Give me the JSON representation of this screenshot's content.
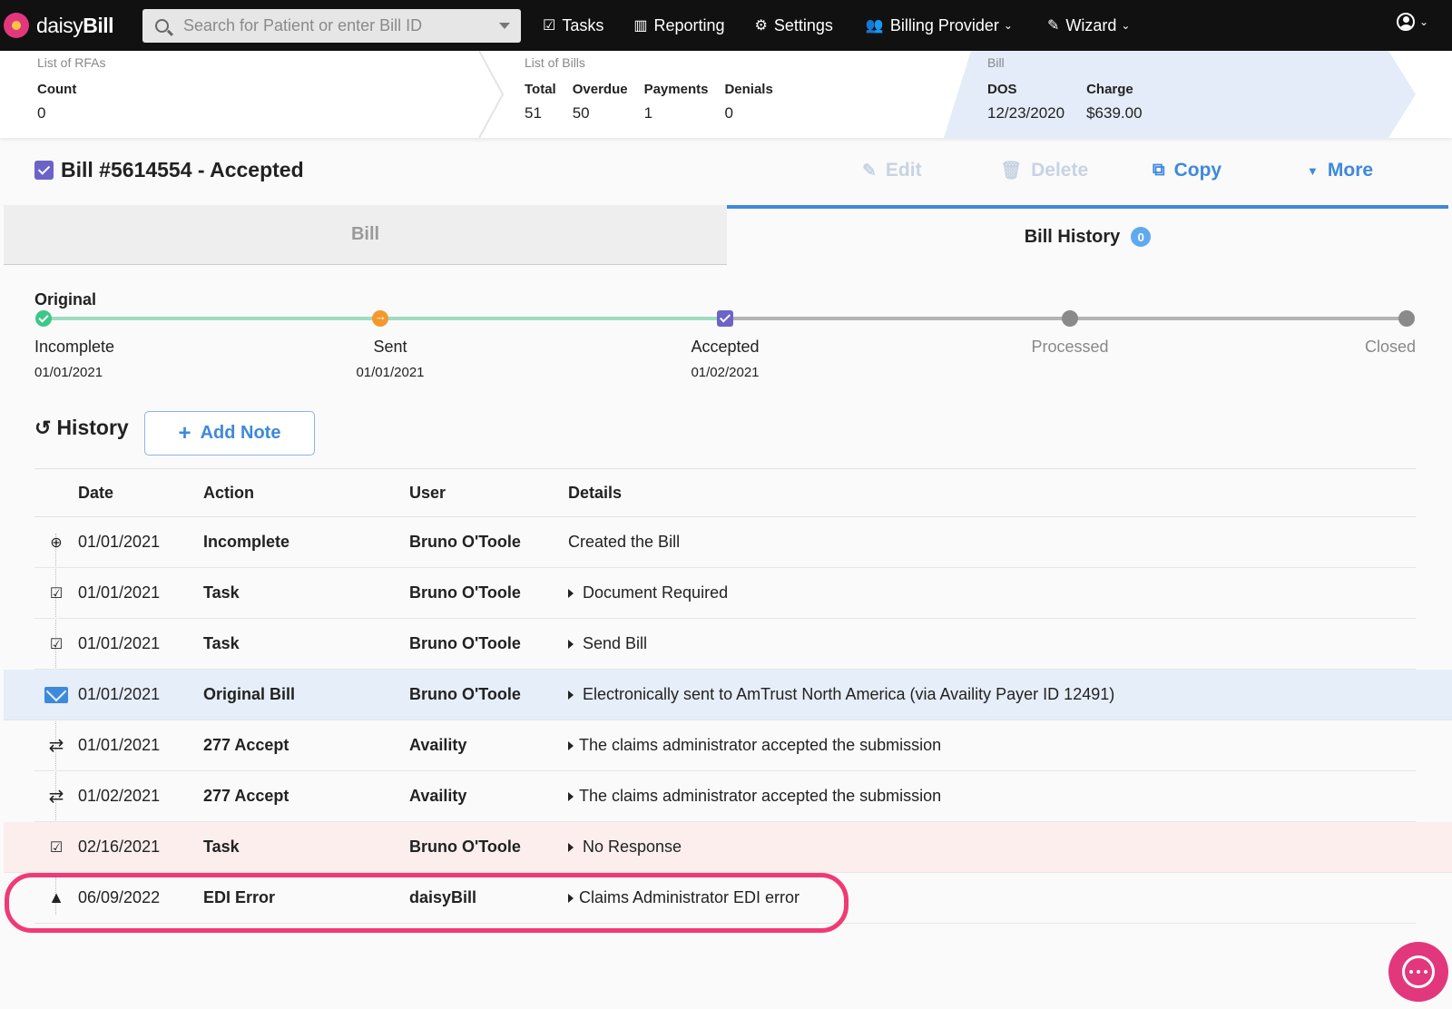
{
  "nav": {
    "logo_light": "daisy",
    "logo_bold": "Bill",
    "search_placeholder": "Search for Patient or enter Bill ID",
    "items": [
      {
        "label": "Tasks",
        "icon": "clipboard-check-icon"
      },
      {
        "label": "Reporting",
        "icon": "bar-chart-icon"
      },
      {
        "label": "Settings",
        "icon": "gear-icon"
      },
      {
        "label": "Billing Provider",
        "icon": "users-icon"
      },
      {
        "label": "Wizard",
        "icon": "magic-wand-icon"
      }
    ]
  },
  "crumbs": {
    "rfas": {
      "title": "List of RFAs",
      "count_label": "Count",
      "count_value": "0"
    },
    "bills": {
      "title": "List of Bills",
      "cols": [
        {
          "label": "Total",
          "value": "51"
        },
        {
          "label": "Overdue",
          "value": "50"
        },
        {
          "label": "Payments",
          "value": "1"
        },
        {
          "label": "Denials",
          "value": "0"
        }
      ]
    },
    "bill": {
      "title": "Bill",
      "dos_label": "DOS",
      "dos_value": "12/23/2020",
      "charge_label": "Charge",
      "charge_value": "$639.00"
    }
  },
  "bill_header": {
    "title": "Bill #5614554 - Accepted",
    "edit": "Edit",
    "delete": "Delete",
    "copy": "Copy",
    "more": "More"
  },
  "tabs": {
    "bill": "Bill",
    "history": "Bill History",
    "history_count": "0"
  },
  "progress": {
    "label": "Original",
    "stages": [
      {
        "name": "Incomplete",
        "date": "01/01/2021"
      },
      {
        "name": "Sent",
        "date": "01/01/2021"
      },
      {
        "name": "Accepted",
        "date": "01/02/2021"
      },
      {
        "name": "Processed",
        "date": ""
      },
      {
        "name": "Closed",
        "date": ""
      }
    ]
  },
  "history": {
    "heading": "History",
    "add_note": "Add Note",
    "columns": {
      "date": "Date",
      "action": "Action",
      "user": "User",
      "details": "Details"
    },
    "rows": [
      {
        "icon": "plus-circle-icon",
        "date": "01/01/2021",
        "action": "Incomplete",
        "user": "Bruno O'Toole",
        "details": "Created the Bill",
        "expandable": false
      },
      {
        "icon": "clipboard-check-icon",
        "date": "01/01/2021",
        "action": "Task",
        "user": "Bruno O'Toole",
        "details": "Document Required",
        "expandable": true
      },
      {
        "icon": "clipboard-check-icon",
        "date": "01/01/2021",
        "action": "Task",
        "user": "Bruno O'Toole",
        "details": "Send Bill",
        "expandable": true
      },
      {
        "icon": "envelope-icon",
        "date": "01/01/2021",
        "action": "Original Bill",
        "user": "Bruno O'Toole",
        "details": "Electronically sent to AmTrust North America (via Availity Payer ID 12491)",
        "expandable": true
      },
      {
        "icon": "exchange-icon",
        "date": "01/01/2021",
        "action": "277 Accept",
        "user": "Availity",
        "details": "The claims administrator accepted the submission",
        "expandable": true
      },
      {
        "icon": "exchange-icon",
        "date": "01/02/2021",
        "action": "277 Accept",
        "user": "Availity",
        "details": "The claims administrator accepted the submission",
        "expandable": true
      },
      {
        "icon": "clipboard-check-icon",
        "date": "02/16/2021",
        "action": "Task",
        "user": "Bruno O'Toole",
        "details": "No Response",
        "expandable": true
      },
      {
        "icon": "warning-icon",
        "date": "06/09/2022",
        "action": "EDI Error",
        "user": "daisyBill",
        "details": "Claims Administrator EDI error",
        "expandable": true
      }
    ]
  },
  "colors": {
    "accent": "#3d89dc",
    "brand": "#e2377d",
    "highlight": "#f03a75",
    "accepted": "#6b63c8",
    "complete": "#3ec78b",
    "sent": "#f29a2e"
  }
}
